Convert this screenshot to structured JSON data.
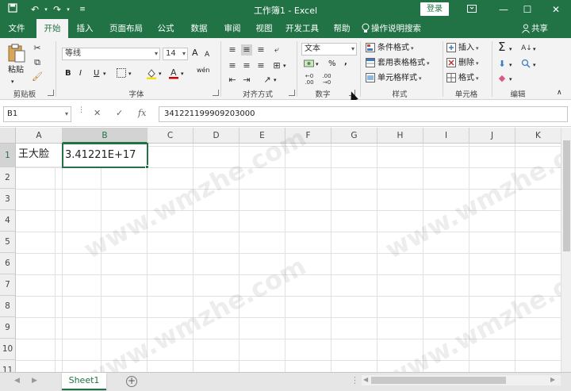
{
  "titlebar": {
    "title": "工作簿1  -  Excel",
    "login": "登录",
    "icons": [
      "save-icon",
      "undo-icon",
      "redo-icon",
      "customize-icon"
    ],
    "controls": [
      "ribbon-display-icon",
      "minimize-icon",
      "maximize-icon",
      "close-icon"
    ]
  },
  "menu": {
    "tabs": [
      "文件",
      "开始",
      "插入",
      "页面布局",
      "公式",
      "数据",
      "审阅",
      "视图",
      "开发工具",
      "帮助"
    ],
    "active": "开始",
    "tellme": "操作说明搜索",
    "share": "共享"
  },
  "ribbon": {
    "clipboard": {
      "paste": "粘贴",
      "label": "剪贴板"
    },
    "font": {
      "name": "等线",
      "size": "14",
      "bold": "B",
      "italic": "I",
      "underline": "U",
      "grow": "A",
      "shrink": "A",
      "phonetic": "wén",
      "label": "字体"
    },
    "alignment": {
      "label": "对齐方式"
    },
    "number": {
      "format": "文本",
      "percent": "%",
      "comma": ",",
      "label": "数字"
    },
    "styles": {
      "conditional": "条件格式",
      "table": "套用表格格式",
      "cell": "单元格样式",
      "label": "样式"
    },
    "cells": {
      "insert": "插入",
      "delete": "删除",
      "format": "格式",
      "label": "单元格"
    },
    "editing": {
      "sum": "Σ",
      "label": "编辑"
    }
  },
  "formulabar": {
    "namebox": "B1",
    "cancel": "✕",
    "enter": "✓",
    "fx": "fx",
    "content": "341221199909203000"
  },
  "sheet": {
    "columns": [
      "A",
      "B",
      "C",
      "D",
      "E",
      "F",
      "G",
      "H",
      "I",
      "J",
      "K"
    ],
    "rows": [
      "1",
      "2",
      "3",
      "4",
      "5",
      "6",
      "7",
      "8",
      "9",
      "10",
      "11"
    ],
    "selected_cell": "B1",
    "cells": {
      "A1": "王大脸",
      "B1": "3.41221E+17"
    }
  },
  "sheet_tabs": {
    "active": "Sheet1",
    "add": "+"
  },
  "watermark": "www.wmzhe.com",
  "colors": {
    "accent": "#217346"
  }
}
